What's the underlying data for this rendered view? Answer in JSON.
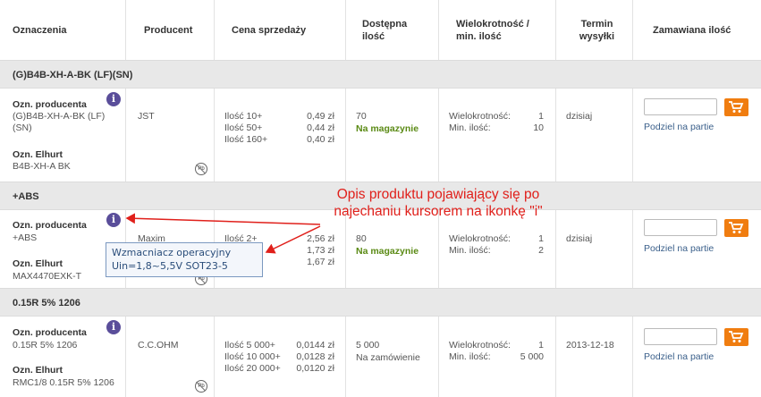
{
  "headers": {
    "designations": "Oznaczenia",
    "producer": "Producent",
    "price": "Cena sprzedaży",
    "available": "Dostępna ilość",
    "multiplicity": "Wielokrotność / min. ilość",
    "term": "Termin wysyłki",
    "order_qty": "Zamawiana ilość"
  },
  "labels": {
    "producer_designation": "Ozn. producenta",
    "elhurt_designation": "Ozn. Elhurt",
    "multiplicity": "Wielokrotność:",
    "min_qty": "Min. ilość:",
    "split_batches": "Podziel na partie"
  },
  "groups": [
    {
      "title": "(G)B4B-XH-A-BK (LF)(SN)",
      "producer_code": "(G)B4B-XH-A-BK (LF)\n(SN)",
      "elhurt_code": "B4B-XH-A BK",
      "producer": "JST",
      "prices": [
        {
          "qty": "Ilość 10+",
          "price": "0,49 zł"
        },
        {
          "qty": "Ilość 50+",
          "price": "0,44 zł"
        },
        {
          "qty": "Ilość 160+",
          "price": "0,40 zł"
        }
      ],
      "available_qty": "70",
      "available_status": "Na magazynie",
      "multiplicity": "1",
      "min_qty": "10",
      "term": "dzisiaj"
    },
    {
      "title": "+ABS",
      "producer_code": "+ABS",
      "elhurt_code": "MAX4470EXK-T",
      "producer": "Maxim",
      "prices": [
        {
          "qty": "Ilość 2+",
          "price": "2,56 zł"
        },
        {
          "qty": "",
          "price": "1,73 zł"
        },
        {
          "qty": "",
          "price": "1,67 zł"
        }
      ],
      "available_qty": "80",
      "available_status": "Na magazynie",
      "multiplicity": "1",
      "min_qty": "2",
      "term": "dzisiaj"
    },
    {
      "title": "0.15R 5% 1206",
      "producer_code": "0.15R 5% 1206",
      "elhurt_code": "RMC1/8 0.15R 5% 1206",
      "producer": "C.C.OHM",
      "prices": [
        {
          "qty": "Ilość 5 000+",
          "price": "0,0144 zł"
        },
        {
          "qty": "Ilość 10 000+",
          "price": "0,0128 zł"
        },
        {
          "qty": "Ilość 20 000+",
          "price": "0,0120 zł"
        }
      ],
      "available_qty": "5 000",
      "available_status": "Na zamówienie",
      "multiplicity": "1",
      "min_qty": "5 000",
      "term": "2013-12-18"
    }
  ],
  "tooltip": {
    "line1": "Wzmacniacz operacyjny",
    "line2": "Uin=1,8~5,5V SOT23-5"
  },
  "annotation": {
    "line1": "Opis produktu pojawiający się po",
    "line2": "najechaniu kursorem na ikonkę \"i\""
  },
  "icons": {
    "info": "i",
    "no_pb": "Pb"
  },
  "colors": {
    "accent": "#f07d10",
    "annotation": "#e0201b",
    "in_stock": "#5a8a14"
  }
}
